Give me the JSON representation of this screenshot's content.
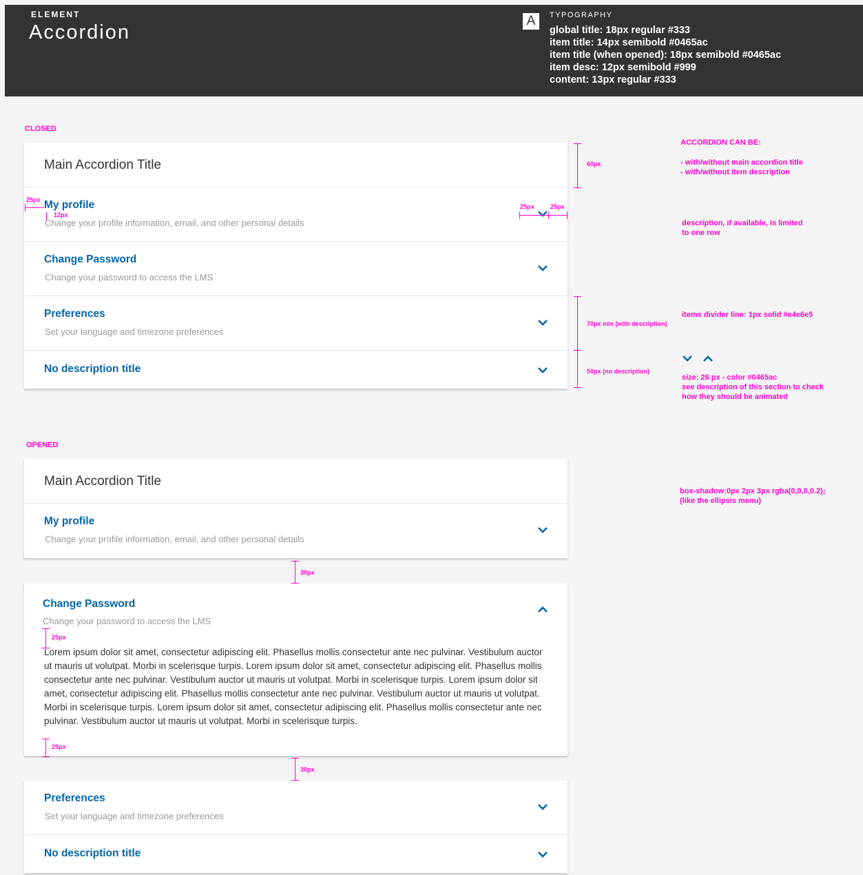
{
  "header": {
    "eyebrow": "ELEMENT",
    "title": "Accordion",
    "typography_badge": "A",
    "typography_label": "TYPOGRAPHY",
    "typography_lines": [
      "global title: 18px regular #333",
      "item title: 14px semibold #0465ac",
      "item title (when opened): 18px semibold #0465ac",
      "item desc: 12px semibold #999",
      "content: 13px regular #333"
    ]
  },
  "colors": {
    "accent": "#0465ac",
    "annotation": "#ff00cc",
    "header_bg": "#333333",
    "divider": "#e4e6e5",
    "desc_text": "#999999"
  },
  "sections": {
    "closed_label": "CLOSED",
    "opened_label": "OPENED"
  },
  "accordion": {
    "main_title": "Main Accordion Title",
    "items": [
      {
        "title": "My profile",
        "desc": "Change your profile information, email, and other personal details"
      },
      {
        "title": "Change Password",
        "desc": "Change your password to access the LMS"
      },
      {
        "title": "Preferences",
        "desc": "Set your language and timezone preferences"
      },
      {
        "title": "No description title",
        "desc": ""
      }
    ],
    "content": "Lorem ipsum dolor sit amet, consectetur adipiscing elit. Phasellus mollis consectetur ante nec pulvinar. Vestibulum auctor ut mauris ut volutpat. Morbi in scelerisque turpis. Lorem ipsum dolor sit amet, consectetur adipiscing elit. Phasellus mollis consectetur ante nec pulvinar. Vestibulum auctor ut mauris ut volutpat. Morbi in scelerisque turpis. Lorem ipsum dolor sit amet, consectetur adipiscing elit. Phasellus mollis consectetur ante nec pulvinar. Vestibulum auctor ut mauris ut volutpat. Morbi in scelerisque turpis. Lorem ipsum dolor sit amet, consectetur adipiscing elit. Phasellus mollis consectetur ante nec pulvinar. Vestibulum auctor ut mauris ut volutpat. Morbi in scelerisque turpis."
  },
  "annotations": {
    "can_be_title": "ACCORDION CAN BE:",
    "can_be_lines": [
      "- with/without main accordion title",
      "- with/without item description"
    ],
    "desc_limit": [
      "description, if available, is limited",
      "to one row"
    ],
    "divider": "items divider line: 1px solid #e4e6e5",
    "icon_spec": [
      "size: 26 px  - color #0465ac",
      "see description of this section to check",
      "how they should be animated"
    ],
    "shadow": [
      "box-shadow:0px 2px 3px rgba(0,0,0,0.2);",
      "(like the ellipsis menu)"
    ],
    "dim_60": "60px",
    "dim_70": "70px min (with description)",
    "dim_50": "50px (no description)",
    "dim_25": "25px",
    "dim_12": "12px",
    "dim_30": "30px"
  }
}
